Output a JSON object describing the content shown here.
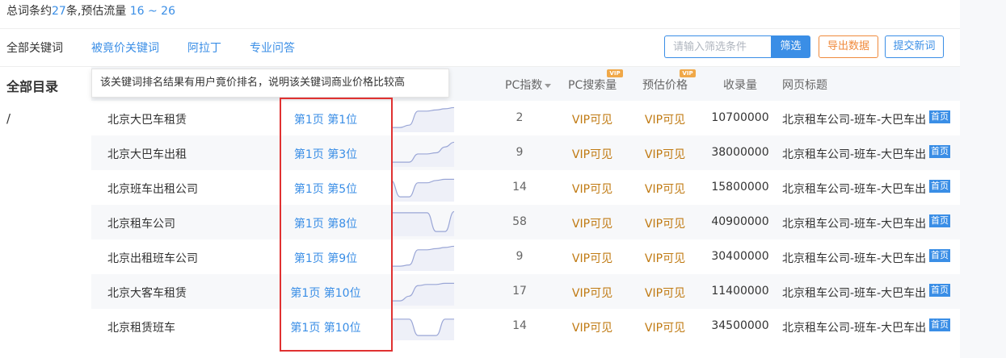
{
  "summary": {
    "prefix": "总词条约",
    "count": "27",
    "mid": "条,预估流量 ",
    "range": "16 ~ 26"
  },
  "tabs": [
    {
      "label": "全部关键词"
    },
    {
      "label": "被竟价关键词"
    },
    {
      "label": "阿拉丁"
    },
    {
      "label": "专业问答"
    }
  ],
  "toolbar": {
    "search_placeholder": "请输入筛选条件",
    "filter_label": "筛选",
    "export_label": "导出数据",
    "submit_label": "提交新词"
  },
  "sidebar": {
    "title": "全部目录",
    "root": "/"
  },
  "tooltip": "该关键词排名结果有用户竟价排名，说明该关键词商业价格比较高",
  "table": {
    "headers": {
      "pc_index": "PC指数",
      "pc_search": "PC搜索量",
      "est_price": "预估价格",
      "indexed": "收录量",
      "page_title": "网页标题"
    },
    "vip_tag": "VIP",
    "rows": [
      {
        "keyword": "北京大巴车租赁",
        "rank": "第1页 第1位",
        "trend": [
          0.1,
          0.1,
          0.2,
          0.8,
          0.8,
          0.85,
          0.9,
          0.95
        ],
        "pc": "2",
        "search": "VIP可见",
        "price": "VIP可见",
        "indexed": "10700000",
        "title": "北京租车公司-班车-大巴车出",
        "badge": "首页"
      },
      {
        "keyword": "北京大巴车出租",
        "rank": "第1页 第3位",
        "trend": [
          0.1,
          0.1,
          0.1,
          0.45,
          0.45,
          0.5,
          0.75,
          0.95
        ],
        "pc": "9",
        "search": "VIP可见",
        "price": "VIP可见",
        "indexed": "38000000",
        "title": "北京租车公司-班车-大巴车出",
        "badge": "首页"
      },
      {
        "keyword": "北京班车出租公司",
        "rank": "第1页 第5位",
        "trend": [
          0.8,
          0.1,
          0.1,
          0.7,
          0.7,
          0.8,
          0.85,
          0.85
        ],
        "pc": "14",
        "search": "VIP可见",
        "price": "VIP可见",
        "indexed": "15800000",
        "title": "北京租车公司-班车-大巴车出",
        "badge": "首页"
      },
      {
        "keyword": "北京租车公司",
        "rank": "第1页 第8位",
        "trend": [
          0.9,
          0.9,
          0.9,
          0.9,
          0.9,
          0.1,
          0.1,
          0.95
        ],
        "pc": "58",
        "search": "VIP可见",
        "price": "VIP可见",
        "indexed": "40900000",
        "title": "北京租车公司-班车-大巴车出",
        "badge": "首页"
      },
      {
        "keyword": "北京出租班车公司",
        "rank": "第1页 第9位",
        "trend": [
          0.1,
          0.1,
          0.15,
          0.8,
          0.8,
          0.85,
          0.9,
          0.95
        ],
        "pc": "9",
        "search": "VIP可见",
        "price": "VIP可见",
        "indexed": "30400000",
        "title": "北京租车公司-班车-大巴车出",
        "badge": "首页"
      },
      {
        "keyword": "北京大客车租赁",
        "rank": "第1页 第10位",
        "trend": [
          0.1,
          0.1,
          0.3,
          0.75,
          0.8,
          0.8,
          0.85,
          0.85
        ],
        "pc": "17",
        "search": "VIP可见",
        "price": "VIP可见",
        "indexed": "11400000",
        "title": "北京租车公司-班车-大巴车出",
        "badge": "首页"
      },
      {
        "keyword": "北京租赁班车",
        "rank": "第1页 第10位",
        "trend": [
          0.8,
          0.8,
          0.8,
          0.1,
          0.1,
          0.1,
          0.8,
          0.8
        ],
        "pc": "14",
        "search": "VIP可见",
        "price": "VIP可见",
        "indexed": "34500000",
        "title": "北京租车公司-班车-大巴车出",
        "badge": "首页"
      }
    ]
  },
  "colors": {
    "accent": "#3a8ee6",
    "vip_text": "#c07a12",
    "export": "#f08a3c",
    "highlight_box": "#e03131",
    "trend_line": "#9aa6d6"
  }
}
